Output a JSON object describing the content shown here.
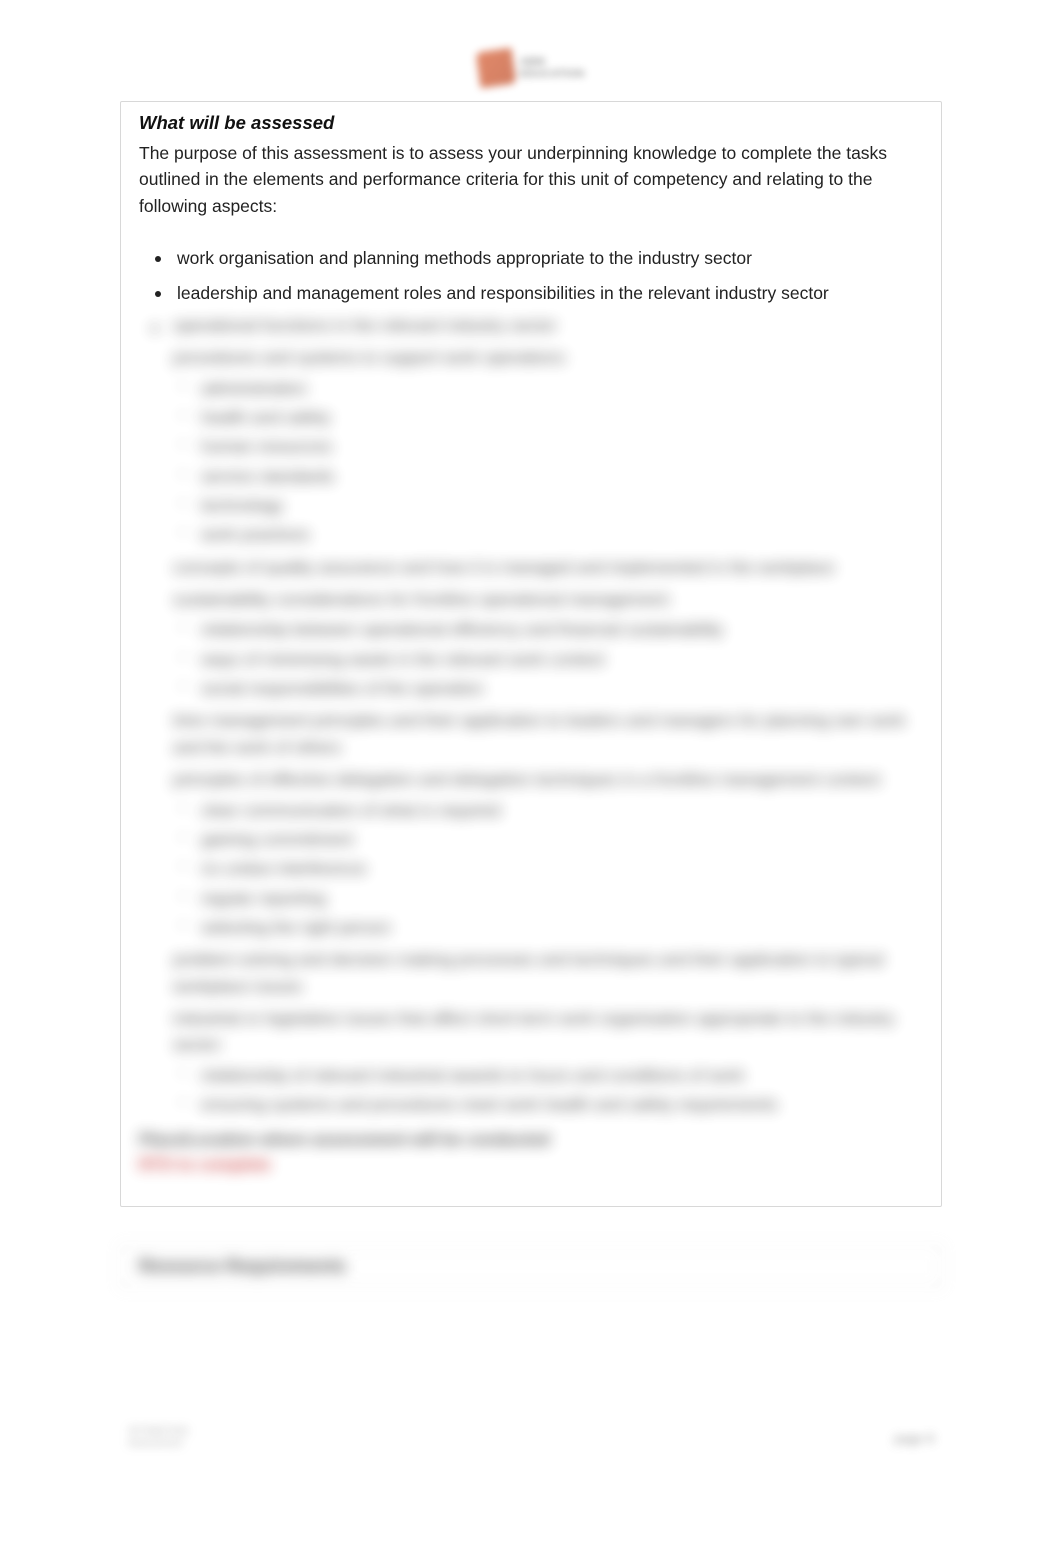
{
  "logo": {
    "line1": "ABM",
    "line2": "EDUCATION"
  },
  "heading": "What will be assessed",
  "intro": "The purpose of this assessment is to assess your underpinning knowledge to complete the tasks outlined in the elements and performance criteria for this unit of competency and relating to the following aspects:",
  "visible_bullets": [
    "work organisation and planning methods appropriate to the industry sector",
    "leadership and management roles and responsibilities in the relevant industry sector"
  ],
  "blurred_bullets": [
    {
      "text": "operational functions in the relevant industry sector",
      "bulleted": true
    },
    {
      "text": "procedures and systems to support work operations:",
      "bulleted": false,
      "subs": [
        "administration",
        "health and safety",
        "human resources",
        "service standards",
        "technology",
        "work practices"
      ]
    },
    {
      "text": "concepts of quality assurance and how it is managed and implemented in the workplace",
      "bulleted": false
    },
    {
      "text": "sustainability considerations for frontline operational management:",
      "bulleted": false,
      "subs": [
        "relationship between operational efficiency and financial sustainability",
        "ways of minimising waste in the relevant work context",
        "social responsibilities of the operation"
      ]
    },
    {
      "text": "time management principles and their application to leaders and managers for planning own work and the work of others",
      "bulleted": false
    },
    {
      "text": "principles of effective delegation and delegation techniques in a frontline management context:",
      "bulleted": false,
      "subs": [
        "clear communication of what is required",
        "gaining commitment",
        "no undue interference",
        "regular reporting",
        "selecting the right person"
      ]
    },
    {
      "text": "problem-solving and decision making processes and techniques and their application to typical workplace issues",
      "bulleted": false
    },
    {
      "text": "industrial or legislative issues that affect short-term work organisation appropriate to the industry sector:",
      "bulleted": false,
      "subs": [
        "relationship of relevant industrial awards to hours and conditions of work",
        "ensuring systems and procedures meet work health and safety requirements"
      ]
    }
  ],
  "final_bold": "Place/Location where assessment will be conducted",
  "final_red": "RTO to complete",
  "section_title": "Resource Requirements",
  "footer_left_1": "SITXMGT001",
  "footer_left_2": "Assessment",
  "footer_right": "page 9"
}
